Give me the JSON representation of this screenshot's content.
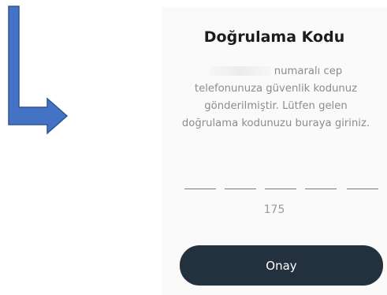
{
  "dialog": {
    "title": "Doğrulama Kodu",
    "description_line1_suffix": "numaralı cep",
    "description_line2": "telefonunuza güvenlik kodunuz",
    "description_line3": "gönderilmiştir. Lütfen gelen",
    "description_line4": "doğrulama kodunuzu buraya giriniz.",
    "code_slots": 5,
    "timer_value": "175",
    "confirm_label": "Onay"
  },
  "colors": {
    "arrow": "#4472c4",
    "button": "#23303d"
  },
  "icons": {
    "annotation": "arrow-down-right-icon"
  }
}
